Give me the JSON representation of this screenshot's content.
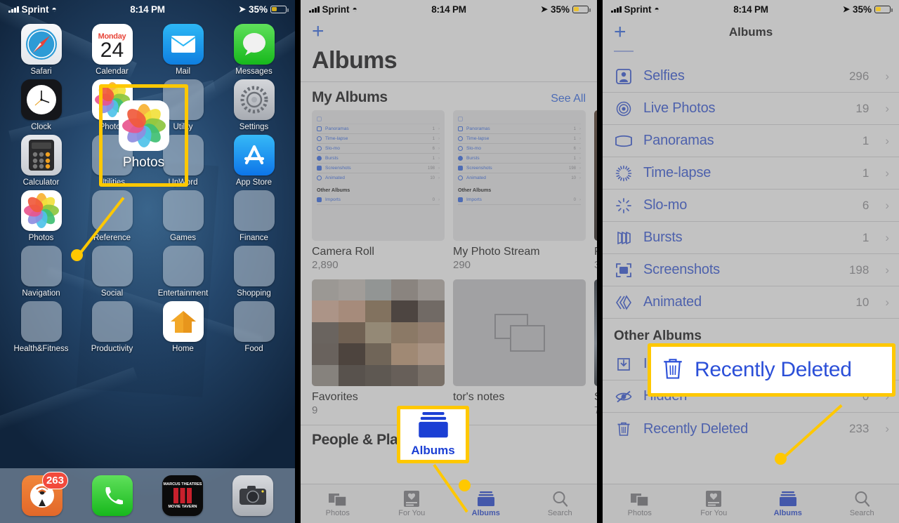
{
  "status_bar": {
    "carrier": "Sprint",
    "time": "8:14 PM",
    "battery": "35%"
  },
  "left_phone": {
    "rows": [
      [
        {
          "label": "Safari",
          "icon": "safari-icon"
        },
        {
          "label": "Calendar",
          "icon": "calendar-icon",
          "day": "Monday",
          "date": "24"
        },
        {
          "label": "Mail",
          "icon": "mail-icon"
        },
        {
          "label": "Messages",
          "icon": "messages-icon"
        }
      ],
      [
        {
          "label": "Clock",
          "icon": "clock-icon"
        },
        {
          "label": "Photos",
          "icon": "photos-icon"
        },
        {
          "label": "Utility",
          "icon": "folder-icon"
        },
        {
          "label": "Settings",
          "icon": "settings-icon"
        }
      ],
      [
        {
          "label": "Calculator",
          "icon": "calculator-icon"
        },
        {
          "label": "Utilities",
          "icon": "folder-icon"
        },
        {
          "label": "UpWord",
          "icon": "folder-icon"
        },
        {
          "label": "App Store",
          "icon": "appstore-icon"
        }
      ],
      [
        {
          "label": "Photos",
          "icon": "photos-icon"
        },
        {
          "label": "Reference",
          "icon": "folder-icon"
        },
        {
          "label": "Games",
          "icon": "folder-icon"
        },
        {
          "label": "Finance",
          "icon": "folder-icon"
        }
      ],
      [
        {
          "label": "Navigation",
          "icon": "folder-icon"
        },
        {
          "label": "Social",
          "icon": "folder-icon"
        },
        {
          "label": "Entertainment",
          "icon": "folder-icon"
        },
        {
          "label": "Shopping",
          "icon": "folder-icon"
        }
      ],
      [
        {
          "label": "Health&Fitness",
          "icon": "folder-icon"
        },
        {
          "label": "Productivity",
          "icon": "folder-icon"
        },
        {
          "label": "Home",
          "icon": "home-icon"
        },
        {
          "label": "Food",
          "icon": "folder-icon"
        }
      ]
    ],
    "dock": [
      {
        "label": "Podcasts",
        "icon": "podcast-icon",
        "badge": "263"
      },
      {
        "label": "Phone",
        "icon": "phone-icon"
      },
      {
        "label": "Marcus Theatres",
        "icon": "marcus-theatres-icon",
        "line1": "MARCUS THEATRES",
        "line2": "MOVIE TAVERN"
      },
      {
        "label": "Camera",
        "icon": "camera-icon"
      }
    ],
    "callout": {
      "label": "Photos"
    }
  },
  "mid_phone": {
    "add_button": "+",
    "title": "Albums",
    "section": {
      "title": "My Albums",
      "see_all": "See All"
    },
    "mini_list": {
      "rows": [
        {
          "name": "Panoramas",
          "count": "1"
        },
        {
          "name": "Time-lapse",
          "count": "1"
        },
        {
          "name": "Slo-mo",
          "count": "6"
        },
        {
          "name": "Bursts",
          "count": "1"
        },
        {
          "name": "Screenshots",
          "count": "198"
        },
        {
          "name": "Animated",
          "count": "10"
        }
      ],
      "other_header": "Other Albums",
      "imports": {
        "name": "Imports",
        "count": "0"
      }
    },
    "albums": [
      {
        "name": "Camera Roll",
        "count": "2,890"
      },
      {
        "name": "My Photo Stream",
        "count": "290"
      },
      {
        "name": "P",
        "count": "3"
      }
    ],
    "albums_row2": [
      {
        "name": "Favorites",
        "count": "9"
      },
      {
        "name": "tor's notes",
        "count": ""
      },
      {
        "name": "S",
        "count": "7"
      }
    ],
    "people_header": "People & Places",
    "tabs": [
      {
        "label": "Photos",
        "icon": "photos-stack-icon",
        "active": false
      },
      {
        "label": "For You",
        "icon": "for-you-icon",
        "active": false
      },
      {
        "label": "Albums",
        "icon": "albums-icon",
        "active": true
      },
      {
        "label": "Search",
        "icon": "search-icon",
        "active": false
      }
    ],
    "callout": {
      "label": "Albums"
    }
  },
  "right_phone": {
    "add_button": "+",
    "title": "Albums",
    "rows": [
      {
        "name": "Selfies",
        "count": "296",
        "icon": "selfies-icon"
      },
      {
        "name": "Live Photos",
        "count": "19",
        "icon": "live-photos-icon"
      },
      {
        "name": "Panoramas",
        "count": "1",
        "icon": "panorama-icon"
      },
      {
        "name": "Time-lapse",
        "count": "1",
        "icon": "time-lapse-icon"
      },
      {
        "name": "Slo-mo",
        "count": "6",
        "icon": "slo-mo-icon"
      },
      {
        "name": "Bursts",
        "count": "1",
        "icon": "bursts-icon"
      },
      {
        "name": "Screenshots",
        "count": "198",
        "icon": "screenshots-icon"
      },
      {
        "name": "Animated",
        "count": "10",
        "icon": "animated-icon"
      }
    ],
    "other_header": "Other Albums",
    "other_rows": [
      {
        "name": "Imports",
        "count": "",
        "icon": "imports-icon"
      },
      {
        "name": "Hidden",
        "count": "0",
        "icon": "hidden-icon"
      },
      {
        "name": "Recently Deleted",
        "count": "233",
        "icon": "trash-icon"
      }
    ],
    "tabs": [
      {
        "label": "Photos",
        "icon": "photos-stack-icon",
        "active": false
      },
      {
        "label": "For You",
        "icon": "for-you-icon",
        "active": false
      },
      {
        "label": "Albums",
        "icon": "albums-icon",
        "active": true
      },
      {
        "label": "Search",
        "icon": "search-icon",
        "active": false
      }
    ],
    "callout": {
      "label": "Recently Deleted"
    }
  },
  "annotation": {
    "color": "#FFC800"
  }
}
